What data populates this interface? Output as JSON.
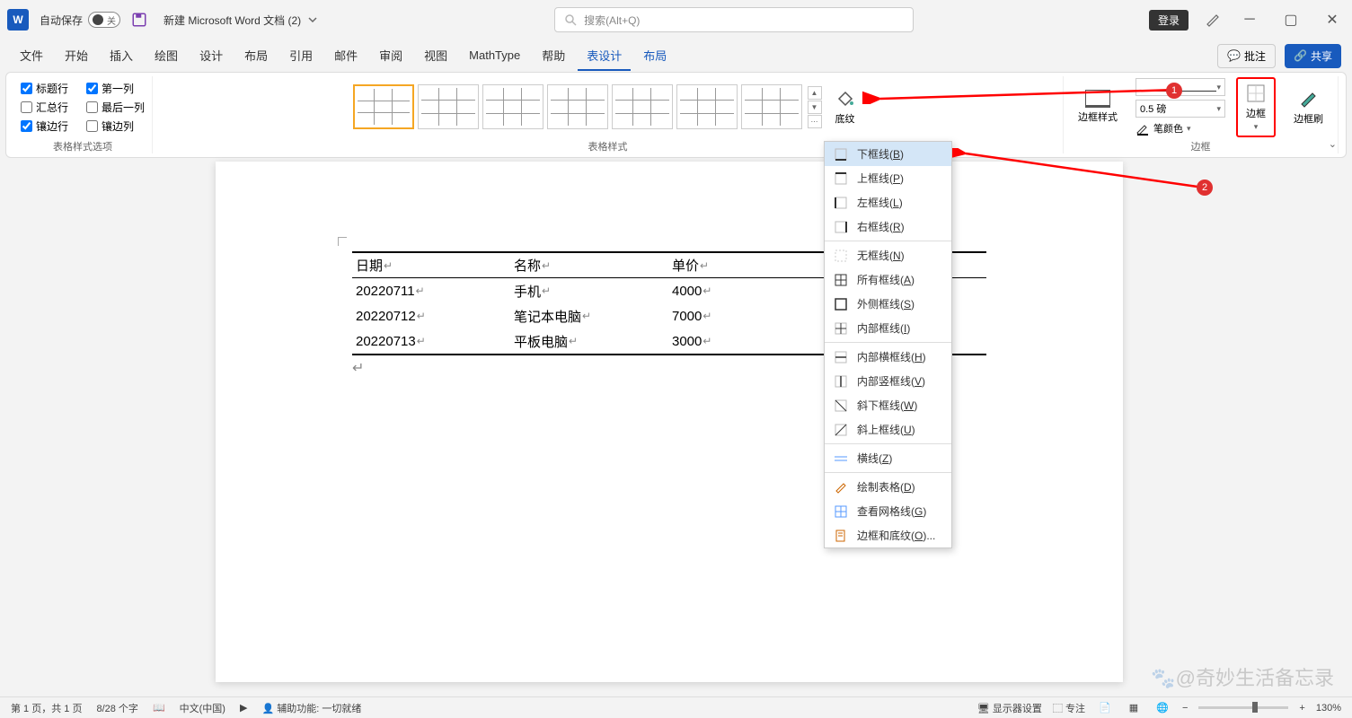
{
  "titlebar": {
    "autosave_label": "自动保存",
    "autosave_state": "关",
    "doc_title": "新建 Microsoft Word 文档 (2)",
    "search_placeholder": "搜索(Alt+Q)",
    "login": "登录"
  },
  "tabs": {
    "items": [
      "文件",
      "开始",
      "插入",
      "绘图",
      "设计",
      "布局",
      "引用",
      "邮件",
      "审阅",
      "视图",
      "MathType",
      "帮助",
      "表设计",
      "布局"
    ],
    "active_index": 12,
    "comments": "批注",
    "share": "共享"
  },
  "ribbon": {
    "options": {
      "header_row": "标题行",
      "total_row": "汇总行",
      "banded_rows": "镶边行",
      "first_col": "第一列",
      "last_col": "最后一列",
      "banded_cols": "镶边列",
      "group_label": "表格样式选项"
    },
    "styles_label": "表格样式",
    "shading": "底纹",
    "border_style": "边框样式",
    "pen_weight": "0.5 磅",
    "pen_color": "笔颜色",
    "borders": "边框",
    "border_painter": "边框刷",
    "borders_group": "边框"
  },
  "dropdown": {
    "items": [
      {
        "label": "下框线",
        "key": "B",
        "icon": "border-bottom"
      },
      {
        "label": "上框线",
        "key": "P",
        "icon": "border-top"
      },
      {
        "label": "左框线",
        "key": "L",
        "icon": "border-left"
      },
      {
        "label": "右框线",
        "key": "R",
        "icon": "border-right"
      },
      {
        "sep": true
      },
      {
        "label": "无框线",
        "key": "N",
        "icon": "border-none"
      },
      {
        "label": "所有框线",
        "key": "A",
        "icon": "border-all"
      },
      {
        "label": "外侧框线",
        "key": "S",
        "icon": "border-outside"
      },
      {
        "label": "内部框线",
        "key": "I",
        "icon": "border-inside"
      },
      {
        "sep": true
      },
      {
        "label": "内部横框线",
        "key": "H",
        "icon": "border-inside-h"
      },
      {
        "label": "内部竖框线",
        "key": "V",
        "icon": "border-inside-v"
      },
      {
        "label": "斜下框线",
        "key": "W",
        "icon": "border-diag-down"
      },
      {
        "label": "斜上框线",
        "key": "U",
        "icon": "border-diag-up"
      },
      {
        "sep": true
      },
      {
        "label": "横线",
        "key": "Z",
        "icon": "hline"
      },
      {
        "sep": true
      },
      {
        "label": "绘制表格",
        "key": "D",
        "icon": "draw-table"
      },
      {
        "label": "查看网格线",
        "key": "G",
        "icon": "gridlines"
      },
      {
        "label": "边框和底纹",
        "key": "O",
        "suffix": "...",
        "icon": "borders-shading"
      }
    ],
    "hover_index": 0
  },
  "document": {
    "headers": [
      "日期",
      "名称",
      "单价",
      ""
    ],
    "rows": [
      [
        "20220711",
        "手机",
        "4000",
        ""
      ],
      [
        "20220712",
        "笔记本电脑",
        "7000",
        ""
      ],
      [
        "20220713",
        "平板电脑",
        "3000",
        ""
      ]
    ]
  },
  "annotations": {
    "badge1": "1",
    "badge2": "2"
  },
  "statusbar": {
    "page": "第 1 页，共 1 页",
    "words": "8/28 个字",
    "lang": "中文(中国)",
    "accessibility": "辅助功能: 一切就绪",
    "display_settings": "显示器设置",
    "focus": "专注",
    "zoom": "130%"
  },
  "watermark": "@奇妙生活备忘录"
}
